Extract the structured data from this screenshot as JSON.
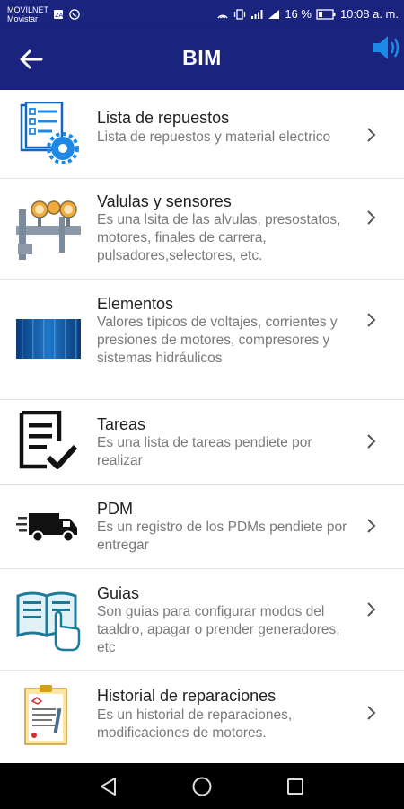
{
  "status_bar": {
    "carrier_1": "MOVILNET",
    "carrier_2": "Movistar",
    "battery": "16 %",
    "time": "10:08 a. m."
  },
  "app_bar": {
    "title": "BIM"
  },
  "items": [
    {
      "title": "Lista de repuestos",
      "description": "Lista de repuestos y material electrico",
      "icon": "parts-list-gear-icon"
    },
    {
      "title": "Valulas y sensores",
      "description": "Es una lsita de las alvulas, presostatos, motores, finales de carrera, pulsadores,selectores, etc.",
      "icon": "valves-gauges-icon"
    },
    {
      "title": "Elementos",
      "description": "Valores típicos de voltajes, corrientes y presiones de motores, compresores y sistemas hidráulicos",
      "icon": "blue-panel-image-icon"
    },
    {
      "title": "Tareas",
      "description": "Es una lista de tareas pendiete por realizar",
      "icon": "task-checklist-icon"
    },
    {
      "title": "PDM",
      "description": "Es un registro de los PDMs pendiete por entregar",
      "icon": "delivery-truck-icon"
    },
    {
      "title": "Guias",
      "description": "Son guias para configurar modos del taaldro, apagar o prender generadores, etc",
      "icon": "open-book-hand-icon"
    },
    {
      "title": "Historial de reparaciones",
      "description": "Es un historial de reparaciones, modificaciones de motores.",
      "icon": "clipboard-history-icon"
    }
  ],
  "colors": {
    "primary": "#1a237e",
    "accent_blue": "#1e88e5",
    "title_text": "#212121",
    "description_text": "#7a7a7a"
  }
}
